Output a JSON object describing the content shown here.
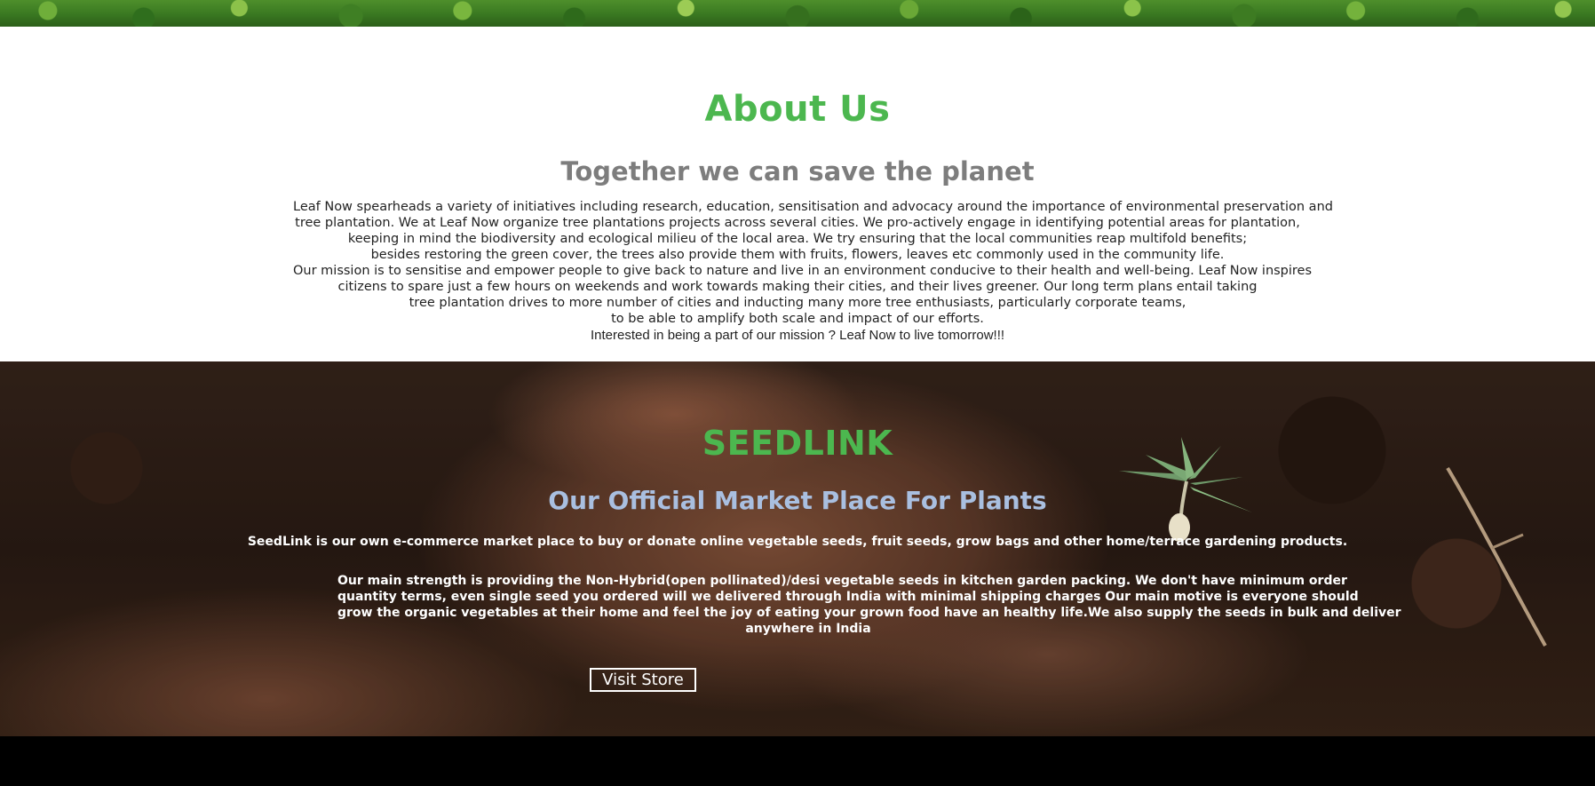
{
  "about": {
    "title": "About Us",
    "subtitle": "Together we can save the planet",
    "lines": [
      "Leaf Now spearheads a variety of initiatives including research, education, sensitisation and advocacy around the importance of environmental preservation and",
      "tree plantation. We at Leaf Now organize tree plantations projects across several cities. We pro-actively engage in identifying potential areas for plantation,",
      "keeping in mind the biodiversity and ecological milieu of the local area. We try ensuring that the local communities reap multifold benefits;",
      "besides restoring the green cover, the trees also provide them with fruits, flowers, leaves etc commonly used in the community life.",
      "Our mission is to sensitise and empower people to give back to nature and live in an environment conducive to their health and well-being. Leaf Now inspires",
      "citizens to spare just a few hours on weekends and work towards making their cities, and their lives greener. Our long term plans entail taking",
      "tree plantation drives to more number of cities and inducting many more tree enthusiasts, particularly corporate teams,",
      "to be able to amplify both scale and impact of our efforts.",
      "Interested in being a part of our mission ? Leaf Now to live tomorrow!!!"
    ]
  },
  "seedlink": {
    "title": "SEEDLINK",
    "subtitle": "Our Official Market Place For Plants",
    "intro": "SeedLink is our own e-commerce market place to buy or donate online vegetable seeds, fruit seeds, grow bags and other home/terrace gardening products.",
    "body_lines": [
      "Our main strength is providing the Non-Hybrid(open pollinated)/desi vegetable seeds in kitchen garden packing. We don't have minimum order",
      "quantity terms, even single seed you ordered will we delivered through India with minimal shipping charges Our main motive is everyone should",
      "grow the organic vegetables at their home and feel the joy of eating your grown food have an healthy life.We also supply the seeds in bulk and deliver",
      "anywhere in India"
    ],
    "button_label": "Visit Store"
  },
  "colors": {
    "accent_green": "#4cb74f",
    "subtitle_gray": "#7d7d7d",
    "subtitle_blue": "#a9bfe0",
    "footer": "#000000"
  },
  "icons": {
    "sprout": "sprout-icon",
    "twig": "twig-icon"
  }
}
